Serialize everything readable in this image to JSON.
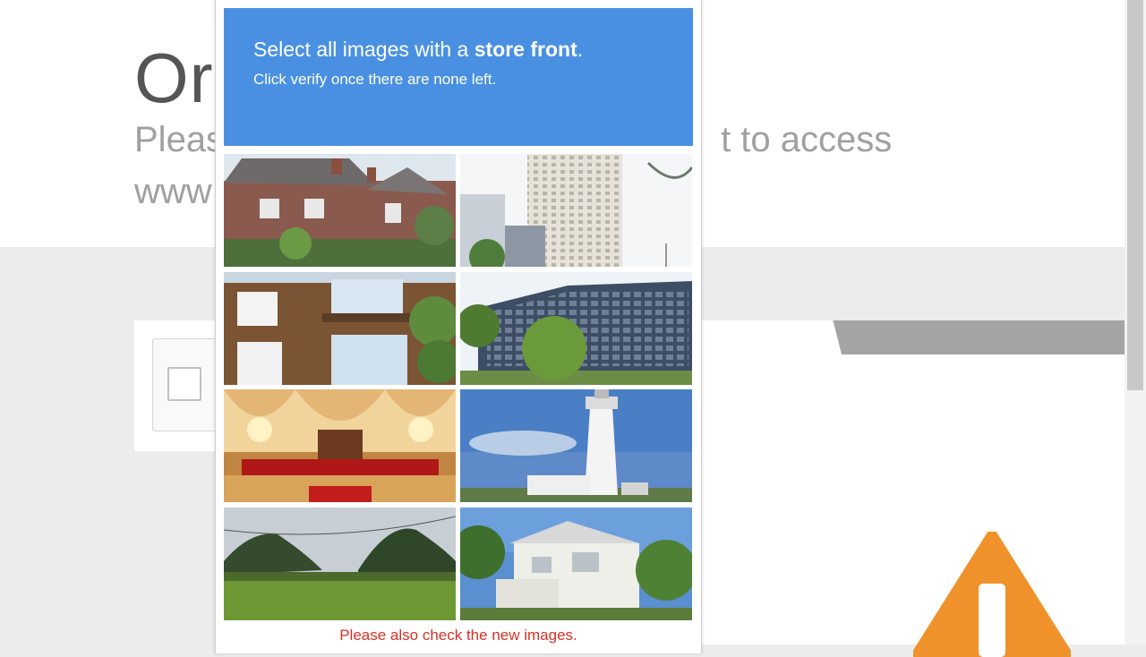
{
  "background_page": {
    "title": "Or",
    "subtitle_left": "Pleas",
    "subtitle_right": "t to access",
    "url_fragment": "www"
  },
  "captcha": {
    "instruction_prefix": "Select all images with a ",
    "instruction_target": "store front",
    "instruction_suffix": ".",
    "subtext": "Click verify once there are none left.",
    "error_text": "Please also check the new images.",
    "header_color": "#4a90e2",
    "tiles": [
      {
        "subject": "brick-cottage"
      },
      {
        "subject": "tall-hotel-tower"
      },
      {
        "subject": "brick-house-windows"
      },
      {
        "subject": "office-block"
      },
      {
        "subject": "decorated-stage"
      },
      {
        "subject": "lighthouse"
      },
      {
        "subject": "green-hills-field"
      },
      {
        "subject": "white-villa"
      }
    ]
  },
  "colors": {
    "accent_blue": "#4a90e2",
    "warning_orange": "#f0922b",
    "error_red": "#d93025"
  }
}
